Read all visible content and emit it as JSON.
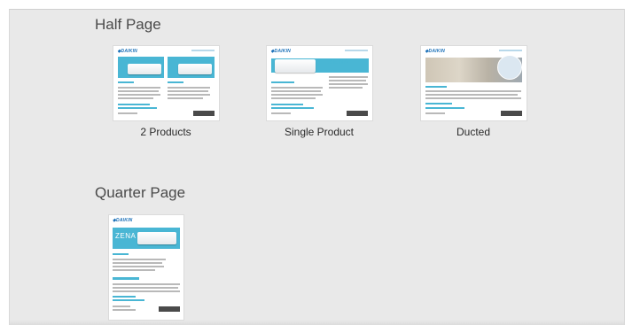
{
  "sections": [
    {
      "title": "Half Page",
      "templates": [
        {
          "label": "2 Products",
          "thumb_icon": "half-page-2-products-preview"
        },
        {
          "label": "Single Product",
          "thumb_icon": "half-page-single-product-preview"
        },
        {
          "label": "Ducted",
          "thumb_icon": "half-page-ducted-preview"
        }
      ]
    },
    {
      "title": "Quarter Page",
      "templates": [
        {
          "label": "",
          "thumb_icon": "quarter-page-zena-preview"
        }
      ]
    }
  ],
  "colors": {
    "panel_bg": "#e9e9e9",
    "accent_blue": "#49b6d4",
    "brand_blue": "#1b70b8"
  }
}
